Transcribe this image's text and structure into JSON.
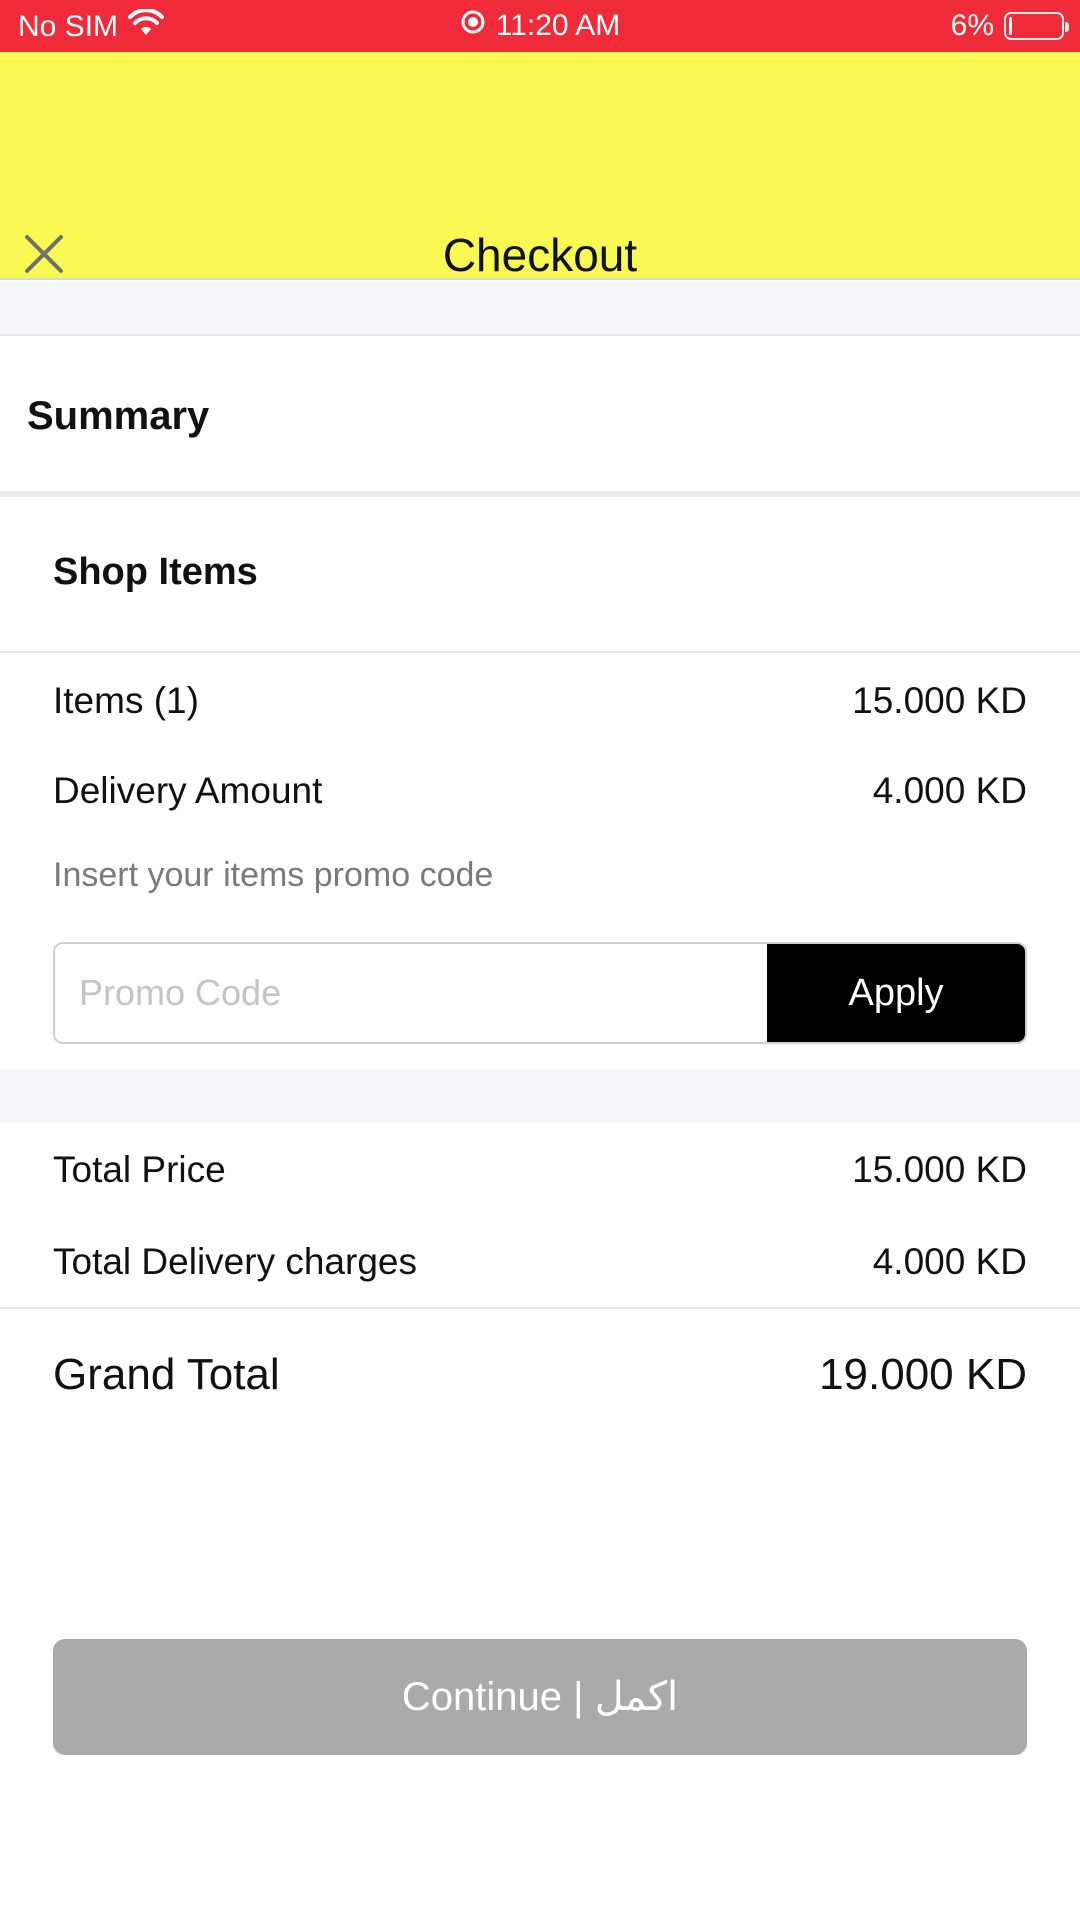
{
  "status_bar": {
    "carrier": "No SIM",
    "wifi_icon": "wifi-icon",
    "time": "11:20 AM",
    "battery_percent": "6%",
    "battery_level": 0.06,
    "bg_color": "#ef2b3a"
  },
  "nav": {
    "title": "Checkout",
    "close_icon": "close-icon",
    "bg_color": "#f8fa53"
  },
  "summary": {
    "title": "Summary"
  },
  "shop": {
    "title": "Shop Items",
    "items_label": "Items (1)",
    "items_value": "15.000 KD",
    "delivery_label": "Delivery Amount",
    "delivery_value": "4.000 KD",
    "promo_hint": "Insert your items promo code",
    "promo_placeholder": "Promo Code",
    "promo_value": "",
    "apply_label": "Apply"
  },
  "totals": {
    "total_price_label": "Total Price",
    "total_price_value": "15.000 KD",
    "total_delivery_label": "Total Delivery charges",
    "total_delivery_value": "4.000 KD",
    "grand_total_label": "Grand Total",
    "grand_total_value": "19.000 KD"
  },
  "footer": {
    "continue_label": "Continue | اكمل"
  }
}
